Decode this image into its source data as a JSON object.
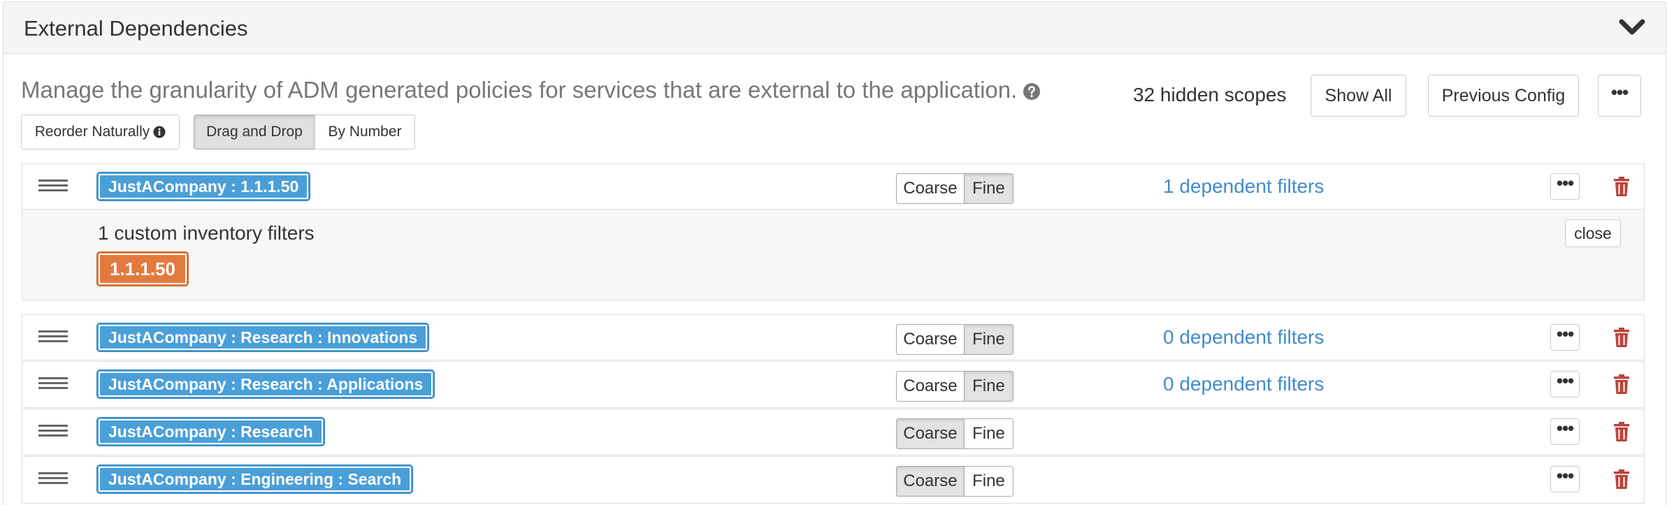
{
  "panel": {
    "title": "External Dependencies",
    "collapse_icon": "chevron-down-icon"
  },
  "description": "Manage the granularity of ADM generated policies for services that are external to the application.",
  "help_icon": "question-circle-icon",
  "hidden_scopes": "32 hidden scopes",
  "toolbar": {
    "show_all": "Show All",
    "previous_config": "Previous Config",
    "more": "•••",
    "reorder_naturally": "Reorder Naturally",
    "drag_and_drop": "Drag and Drop",
    "by_number": "By Number"
  },
  "granularity": {
    "coarse": "Coarse",
    "fine": "Fine"
  },
  "rows": [
    {
      "scope": "JustACompany : 1.1.1.50",
      "selected": "fine",
      "dependent_filters": "1 dependent filters",
      "expanded": {
        "label": "1 custom inventory filters",
        "filter": "1.1.1.50",
        "close": "close"
      }
    },
    {
      "scope": "JustACompany : Research : Innovations",
      "selected": "fine",
      "dependent_filters": "0 dependent filters"
    },
    {
      "scope": "JustACompany : Research : Applications",
      "selected": "fine",
      "dependent_filters": "0 dependent filters"
    },
    {
      "scope": "JustACompany : Research",
      "selected": "coarse",
      "dependent_filters": ""
    },
    {
      "scope": "JustACompany : Engineering : Search",
      "selected": "coarse",
      "dependent_filters": ""
    }
  ],
  "colors": {
    "scope_tag": "#4a9fd8",
    "filter_tag": "#e27a3f",
    "link": "#428bca",
    "trash": "#b9453c"
  }
}
